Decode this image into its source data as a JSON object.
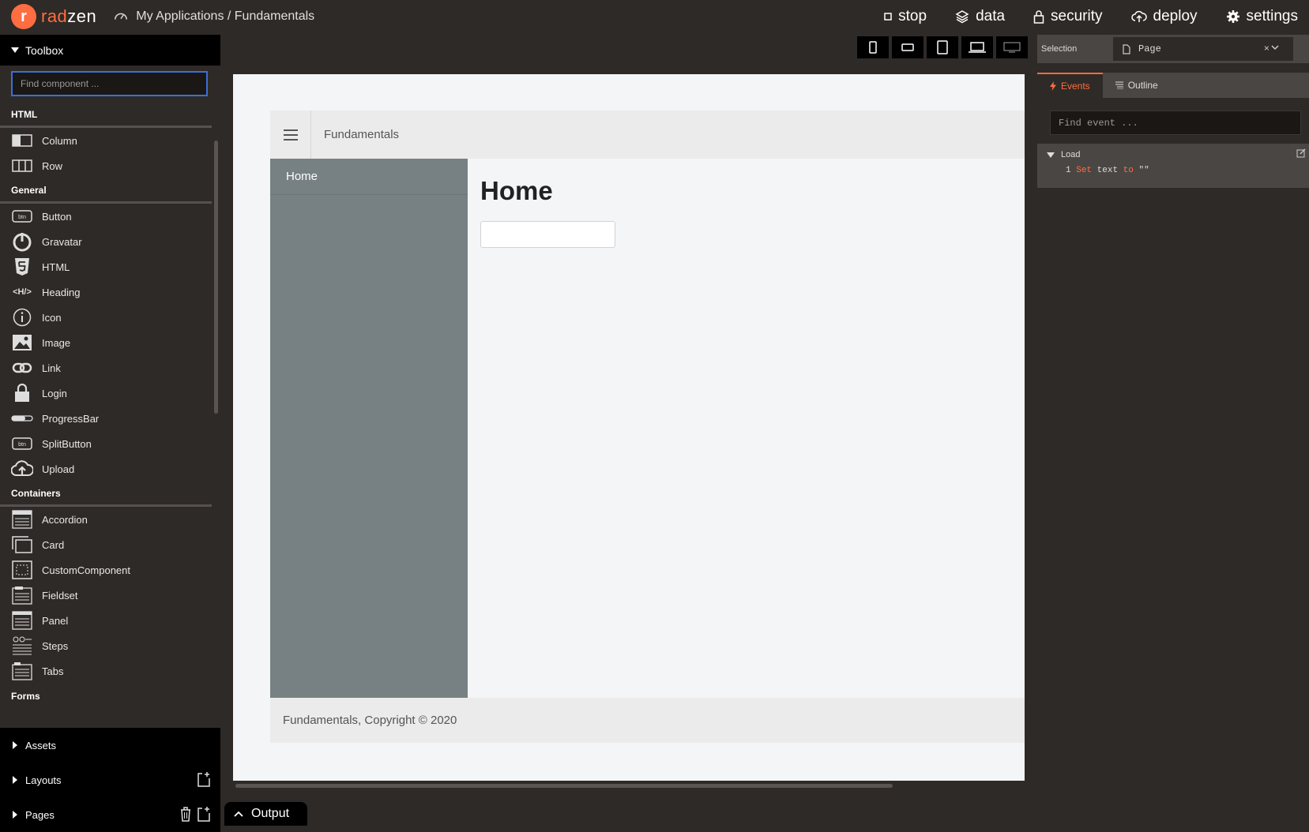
{
  "brand": {
    "logo_letter": "r",
    "name_accent": "rad",
    "name_rest": "zen"
  },
  "breadcrumb": "My Applications / Fundamentals",
  "topnav": [
    {
      "label": "stop",
      "icon": "stop-icon"
    },
    {
      "label": "data",
      "icon": "layers-icon"
    },
    {
      "label": "security",
      "icon": "lock-icon"
    },
    {
      "label": "deploy",
      "icon": "cloud-upload-icon"
    },
    {
      "label": "settings",
      "icon": "gear-icon"
    }
  ],
  "toolbox": {
    "title": "Toolbox",
    "search_placeholder": "Find component ...",
    "sections": {
      "html": "HTML",
      "general": "General",
      "containers": "Containers",
      "forms": "Forms"
    },
    "html_items": [
      "Column",
      "Row"
    ],
    "general_items": [
      "Button",
      "Gravatar",
      "HTML",
      "Heading",
      "Icon",
      "Image",
      "Link",
      "Login",
      "ProgressBar",
      "SplitButton",
      "Upload"
    ],
    "container_items": [
      "Accordion",
      "Card",
      "CustomComponent",
      "Fieldset",
      "Panel",
      "Steps",
      "Tabs"
    ],
    "heading_icon_text": "<H/>",
    "btn_icon_text": "btn",
    "assets": "Assets",
    "layouts": "Layouts",
    "pages": "Pages"
  },
  "canvas": {
    "app_title": "Fundamentals",
    "nav_home": "Home",
    "heading": "Home",
    "footer": "Fundamentals, Copyright © 2020"
  },
  "output_tab": "Output",
  "right_panel": {
    "selection_label": "Selection",
    "selection_value": "Page",
    "selection_clear": "×",
    "tab_events": "Events",
    "tab_outline": "Outline",
    "event_search_placeholder": "Find event ...",
    "event_group": "Load",
    "action_num": "1",
    "action_set": "Set",
    "action_target": "text",
    "action_to": "to",
    "action_value": "\"\""
  },
  "colors": {
    "accent": "#ff6d41",
    "focus": "#3b6fd9",
    "sidebar": "#778184"
  }
}
